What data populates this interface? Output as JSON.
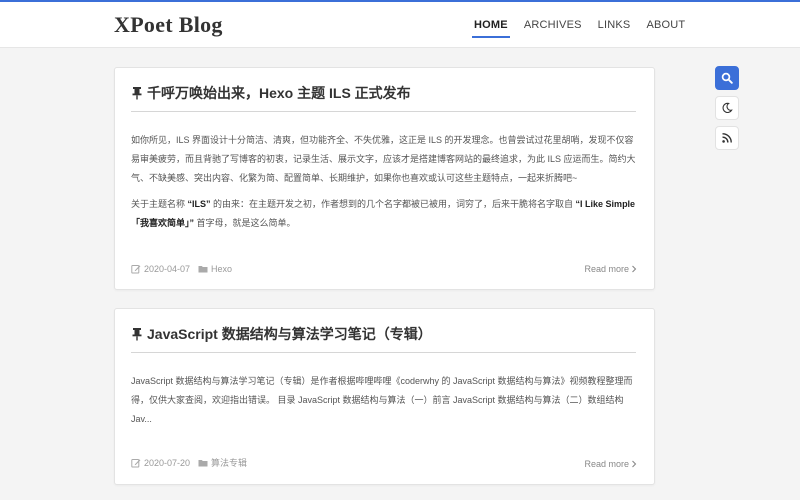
{
  "site": {
    "title": "XPoet Blog",
    "accent": "#3b6fd8"
  },
  "nav": [
    {
      "label": "HOME",
      "active": true
    },
    {
      "label": "ARCHIVES",
      "active": false
    },
    {
      "label": "LINKS",
      "active": false
    },
    {
      "label": "ABOUT",
      "active": false
    }
  ],
  "tools": {
    "search_icon": "search-icon",
    "theme_icon": "moon-icon",
    "rss_icon": "rss-icon"
  },
  "posts": [
    {
      "pinned": true,
      "title": "千呼万唤始出来，Hexo 主题 ILS 正式发布",
      "paragraphs": [
        [
          {
            "t": "如你所见，ILS 界面设计十分简洁、清爽，但功能齐全、不失优雅，这正是 ILS 的开发理念。也曾尝试过花里胡哨，发现不仅容易审美疲劳，而且背驰了写博客的初衷，记录生活、展示文字，应该才是搭建博客网站的最终追求，为此 ILS 应运而生。简约大气、不缺美感、突出内容、化繁为简、配置简单、长期维护，如果你也喜欢或认可这些主题特点，一起来折腾吧~"
          }
        ],
        [
          {
            "t": "关于主题名称 "
          },
          {
            "t": "“ILS”",
            "b": true
          },
          {
            "t": " 的由来：在主题开发之初，作者想到的几个名字都被已被用，词穷了，后来干脆将名字取自 "
          },
          {
            "t": "“I Like Simple「我喜欢简单」”",
            "b": true
          },
          {
            "t": " 首字母，就是这么简单。"
          }
        ]
      ],
      "date": "2020-04-07",
      "category": "Hexo",
      "read_more": "Read more"
    },
    {
      "pinned": true,
      "title": "JavaScript 数据结构与算法学习笔记（专辑）",
      "paragraphs": [
        [
          {
            "t": "JavaScript 数据结构与算法学习笔记（专辑）是作者根据哔哩哔哩《coderwhy 的 JavaScript 数据结构与算法》视频教程整理而得，仅供大家查阅，欢迎指出错误。 目录 JavaScript 数据结构与算法（一）前言 JavaScript 数据结构与算法（二）数组结构 Jav..."
          }
        ]
      ],
      "date": "2020-07-20",
      "category": "算法专辑",
      "read_more": "Read more"
    }
  ]
}
